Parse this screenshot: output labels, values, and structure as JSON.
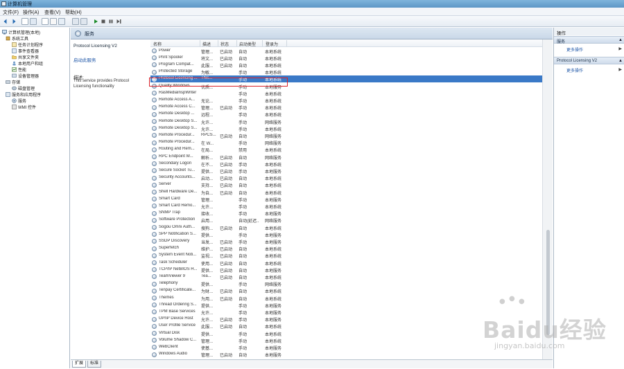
{
  "window": {
    "title": "计算机管理"
  },
  "menu": [
    "文件(F)",
    "操作(A)",
    "查看(V)",
    "帮助(H)"
  ],
  "toolbar": {
    "icons": [
      "back-icon",
      "forward-icon",
      "up-icon",
      "show-hide-tree-icon",
      "properties-icon",
      "help-icon",
      "console-icon",
      "play-icon",
      "stop-icon",
      "pause-icon",
      "restart-icon"
    ]
  },
  "tree": [
    {
      "label": "计算机管理(本地)",
      "level": 0,
      "icon": "computer-icon"
    },
    {
      "label": "系统工具",
      "level": 1,
      "icon": "tools-icon"
    },
    {
      "label": "任务计划程序",
      "level": 2,
      "icon": "task-icon"
    },
    {
      "label": "事件查看器",
      "level": 2,
      "icon": "event-icon"
    },
    {
      "label": "共享文件夹",
      "level": 2,
      "icon": "folder-icon"
    },
    {
      "label": "本地用户和组",
      "level": 2,
      "icon": "users-icon"
    },
    {
      "label": "性能",
      "level": 2,
      "icon": "performance-icon"
    },
    {
      "label": "设备管理器",
      "level": 2,
      "icon": "device-icon"
    },
    {
      "label": "存储",
      "level": 1,
      "icon": "storage-icon"
    },
    {
      "label": "磁盘管理",
      "level": 2,
      "icon": "disk-icon"
    },
    {
      "label": "服务和应用程序",
      "level": 1,
      "icon": "services-apps-icon"
    },
    {
      "label": "服务",
      "level": 2,
      "icon": "services-icon"
    },
    {
      "label": "WMI 控件",
      "level": 2,
      "icon": "wmi-icon"
    }
  ],
  "center": {
    "header": "服务",
    "selected_service_name": "Protocol Licensing V2",
    "start_link": "启动此服务",
    "description_label": "描述:",
    "description_text": "This service provides Protocol Licensing functionality"
  },
  "columns": [
    "名称",
    "描述",
    "状态",
    "启动类型",
    "登录为"
  ],
  "services": [
    {
      "name": "Power",
      "desc": "管理...",
      "status": "已启动",
      "start": "自动",
      "logon": "本地系统"
    },
    {
      "name": "Print Spooler",
      "desc": "将文...",
      "status": "已启动",
      "start": "自动",
      "logon": "本地系统"
    },
    {
      "name": "Program Compat...",
      "desc": "此服...",
      "status": "已启动",
      "start": "自动",
      "logon": "本地系统"
    },
    {
      "name": "Protected Storage",
      "desc": "为敏...",
      "status": "",
      "start": "手动",
      "logon": "本地系统"
    },
    {
      "name": "Protocol Licensing ...",
      "desc": "This...",
      "status": "",
      "start": "手动",
      "logon": "本地系统"
    },
    {
      "name": "Quality Windows ...",
      "desc": "优质...",
      "status": "",
      "start": "手动",
      "logon": "本地服务"
    },
    {
      "name": "RasMediaInspWriter",
      "desc": "",
      "status": "",
      "start": "手动",
      "logon": "本地系统"
    },
    {
      "name": "Remote Access A...",
      "desc": "无论...",
      "status": "",
      "start": "手动",
      "logon": "本地系统"
    },
    {
      "name": "Remote Access C...",
      "desc": "管理...",
      "status": "已启动",
      "start": "手动",
      "logon": "本地系统"
    },
    {
      "name": "Remote Desktop ...",
      "desc": "远程...",
      "status": "",
      "start": "手动",
      "logon": "本地系统"
    },
    {
      "name": "Remote Desktop S...",
      "desc": "允许...",
      "status": "",
      "start": "手动",
      "logon": "网络服务"
    },
    {
      "name": "Remote Desktop S...",
      "desc": "允许...",
      "status": "",
      "start": "手动",
      "logon": "本地系统"
    },
    {
      "name": "Remote Procedur...",
      "desc": "RPCS...",
      "status": "已启动",
      "start": "自动",
      "logon": "网络服务"
    },
    {
      "name": "Remote Procedur...",
      "desc": "在 W...",
      "status": "",
      "start": "手动",
      "logon": "网络服务"
    },
    {
      "name": "Routing and Rem...",
      "desc": "在局...",
      "status": "",
      "start": "禁用",
      "logon": "本地系统"
    },
    {
      "name": "RPC Endpoint M...",
      "desc": "解析...",
      "status": "已启动",
      "start": "自动",
      "logon": "网络服务"
    },
    {
      "name": "Secondary Logon",
      "desc": "在不...",
      "status": "已启动",
      "start": "手动",
      "logon": "本地系统"
    },
    {
      "name": "Secure Socket Tu...",
      "desc": "提供...",
      "status": "已启动",
      "start": "手动",
      "logon": "本地服务"
    },
    {
      "name": "Security Accounts...",
      "desc": "启动...",
      "status": "已启动",
      "start": "自动",
      "logon": "本地系统"
    },
    {
      "name": "Server",
      "desc": "支持...",
      "status": "已启动",
      "start": "自动",
      "logon": "本地系统"
    },
    {
      "name": "Shell Hardware De...",
      "desc": "为自...",
      "status": "已启动",
      "start": "自动",
      "logon": "本地系统"
    },
    {
      "name": "Smart Card",
      "desc": "管理...",
      "status": "",
      "start": "手动",
      "logon": "本地服务"
    },
    {
      "name": "Smart Card Remo...",
      "desc": "允许...",
      "status": "",
      "start": "手动",
      "logon": "本地系统"
    },
    {
      "name": "SNMP Trap",
      "desc": "接收...",
      "status": "",
      "start": "手动",
      "logon": "本地服务"
    },
    {
      "name": "Software Protection",
      "desc": "启用...",
      "status": "",
      "start": "自动(延迟...",
      "logon": "网络服务"
    },
    {
      "name": "Sogou Omni Auth...",
      "desc": "搜狗...",
      "status": "已启动",
      "start": "自动",
      "logon": "本地系统"
    },
    {
      "name": "SPP Notification S...",
      "desc": "提供...",
      "status": "",
      "start": "手动",
      "logon": "本地服务"
    },
    {
      "name": "SSDP Discovery",
      "desc": "当发...",
      "status": "已启动",
      "start": "手动",
      "logon": "本地服务"
    },
    {
      "name": "Superfetch",
      "desc": "维护...",
      "status": "已启动",
      "start": "自动",
      "logon": "本地系统"
    },
    {
      "name": "System Event Noti...",
      "desc": "监视...",
      "status": "已启动",
      "start": "自动",
      "logon": "本地系统"
    },
    {
      "name": "Task Scheduler",
      "desc": "使用...",
      "status": "已启动",
      "start": "自动",
      "logon": "本地系统"
    },
    {
      "name": "TCP/IP NetBIOS H...",
      "desc": "提供...",
      "status": "已启动",
      "start": "自动",
      "logon": "本地服务"
    },
    {
      "name": "TeamViewer 9",
      "desc": "Tea...",
      "status": "已启动",
      "start": "自动",
      "logon": "本地系统"
    },
    {
      "name": "Telephony",
      "desc": "提供...",
      "status": "",
      "start": "手动",
      "logon": "网络服务"
    },
    {
      "name": "Tenpay Certificate...",
      "desc": "为财...",
      "status": "已启动",
      "start": "自动",
      "logon": "本地系统"
    },
    {
      "name": "Themes",
      "desc": "为用...",
      "status": "已启动",
      "start": "自动",
      "logon": "本地系统"
    },
    {
      "name": "Thread Ordering S...",
      "desc": "提供...",
      "status": "",
      "start": "手动",
      "logon": "本地服务"
    },
    {
      "name": "TPM Base Services",
      "desc": "允许...",
      "status": "",
      "start": "手动",
      "logon": "本地服务"
    },
    {
      "name": "UPnP Device Host",
      "desc": "允许...",
      "status": "已启动",
      "start": "手动",
      "logon": "本地服务"
    },
    {
      "name": "User Profile Service",
      "desc": "此服...",
      "status": "已启动",
      "start": "自动",
      "logon": "本地系统"
    },
    {
      "name": "Virtual Disk",
      "desc": "提供...",
      "status": "",
      "start": "手动",
      "logon": "本地系统"
    },
    {
      "name": "Volume Shadow C...",
      "desc": "管理...",
      "status": "",
      "start": "手动",
      "logon": "本地系统"
    },
    {
      "name": "WebClient",
      "desc": "使基...",
      "status": "",
      "start": "手动",
      "logon": "本地服务"
    },
    {
      "name": "Windows Audio",
      "desc": "管理...",
      "status": "已启动",
      "start": "自动",
      "logon": "本地服务"
    }
  ],
  "selected_index": 4,
  "tabs": [
    "扩展",
    "标准"
  ],
  "actions": {
    "title": "操作",
    "sections": [
      {
        "label": "服务",
        "items": [
          "更多操作"
        ]
      },
      {
        "label": "Protocol Licensing V2",
        "items": [
          "更多操作"
        ]
      }
    ]
  },
  "watermark": {
    "main": "Baidu经验",
    "sub": "jingyan.baidu.com"
  },
  "colors": {
    "selection": "#3a79c7",
    "highlight_border": "#d9222a",
    "link": "#1f57a8"
  }
}
